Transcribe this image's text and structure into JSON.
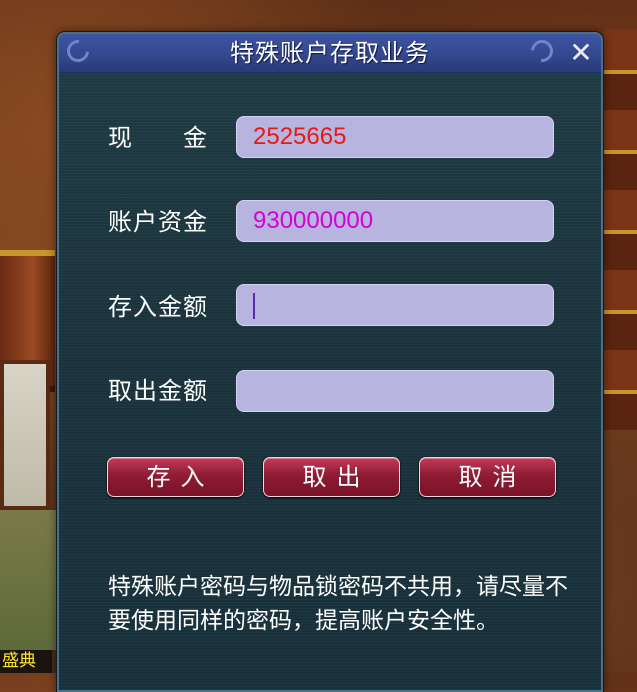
{
  "dialog": {
    "title": "特殊账户存取业务",
    "close_symbol": "✕"
  },
  "fields": {
    "cash": {
      "label": "现　　金",
      "value": "2525665"
    },
    "account_funds": {
      "label": "账户资金",
      "value": "930000000"
    },
    "deposit_amount": {
      "label": "存入金额",
      "value": ""
    },
    "withdraw_amount": {
      "label": "取出金额",
      "value": ""
    }
  },
  "buttons": {
    "deposit": "存入",
    "withdraw": "取出",
    "cancel": "取消"
  },
  "notice": "特殊账户密码与物品锁密码不共用，请尽量不要使用同样的密码，提高账户安全性。",
  "background": {
    "partial_label": "盛典"
  },
  "colors": {
    "cash_value": "#e81818",
    "account_value": "#d400d4",
    "button": "#8e1c34",
    "title_bar": "#33468e",
    "input_bg": "#b8b4e0"
  }
}
